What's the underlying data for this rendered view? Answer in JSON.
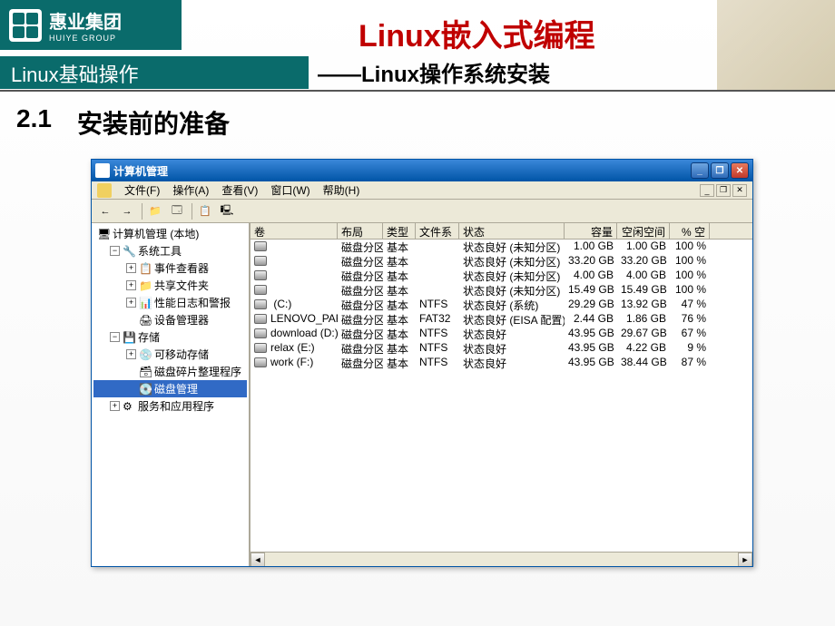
{
  "slide": {
    "logo_cn": "惠业集团",
    "logo_en": "HUIYE GROUP",
    "main_title": "Linux嵌入式编程",
    "sub_main": "——Linux操作系统安装",
    "subtitle_bar": "Linux基础操作",
    "section_num": "2.1",
    "section_title": "安装前的准备"
  },
  "window": {
    "title": "计算机管理",
    "menu": {
      "file": "文件(F)",
      "action": "操作(A)",
      "view": "查看(V)",
      "window": "窗口(W)",
      "help": "帮助(H)"
    },
    "tree": {
      "root": "计算机管理 (本地)",
      "systools": "系统工具",
      "eventviewer": "事件查看器",
      "sharedfolders": "共享文件夹",
      "perflogs": "性能日志和警报",
      "devmgr": "设备管理器",
      "storage": "存储",
      "removable": "可移动存储",
      "defrag": "磁盘碎片整理程序",
      "diskmgmt": "磁盘管理",
      "services": "服务和应用程序"
    },
    "columns": {
      "volume": "卷",
      "layout": "布局",
      "type": "类型",
      "filesystem": "文件系统",
      "status": "状态",
      "capacity": "容量",
      "freespace": "空闲空间",
      "pctfree": "% 空闲"
    },
    "volumes": [
      {
        "name": "",
        "layout": "磁盘分区",
        "type": "基本",
        "fs": "",
        "status": "状态良好 (未知分区)",
        "cap": "1.00 GB",
        "free": "1.00 GB",
        "pct": "100 %"
      },
      {
        "name": "",
        "layout": "磁盘分区",
        "type": "基本",
        "fs": "",
        "status": "状态良好 (未知分区)",
        "cap": "33.20 GB",
        "free": "33.20 GB",
        "pct": "100 %"
      },
      {
        "name": "",
        "layout": "磁盘分区",
        "type": "基本",
        "fs": "",
        "status": "状态良好 (未知分区)",
        "cap": "4.00 GB",
        "free": "4.00 GB",
        "pct": "100 %"
      },
      {
        "name": "",
        "layout": "磁盘分区",
        "type": "基本",
        "fs": "",
        "status": "状态良好 (未知分区)",
        "cap": "15.49 GB",
        "free": "15.49 GB",
        "pct": "100 %"
      },
      {
        "name": " (C:)",
        "layout": "磁盘分区",
        "type": "基本",
        "fs": "NTFS",
        "status": "状态良好 (系统)",
        "cap": "29.29 GB",
        "free": "13.92 GB",
        "pct": "47 %"
      },
      {
        "name": "LENOVO_PART",
        "layout": "磁盘分区",
        "type": "基本",
        "fs": "FAT32",
        "status": "状态良好 (EISA 配置)",
        "cap": "2.44 GB",
        "free": "1.86 GB",
        "pct": "76 %"
      },
      {
        "name": "download (D:)",
        "layout": "磁盘分区",
        "type": "基本",
        "fs": "NTFS",
        "status": "状态良好",
        "cap": "43.95 GB",
        "free": "29.67 GB",
        "pct": "67 %"
      },
      {
        "name": "relax (E:)",
        "layout": "磁盘分区",
        "type": "基本",
        "fs": "NTFS",
        "status": "状态良好",
        "cap": "43.95 GB",
        "free": "4.22 GB",
        "pct": "9 %"
      },
      {
        "name": "work (F:)",
        "layout": "磁盘分区",
        "type": "基本",
        "fs": "NTFS",
        "status": "状态良好",
        "cap": "43.95 GB",
        "free": "38.44 GB",
        "pct": "87 %"
      }
    ]
  }
}
